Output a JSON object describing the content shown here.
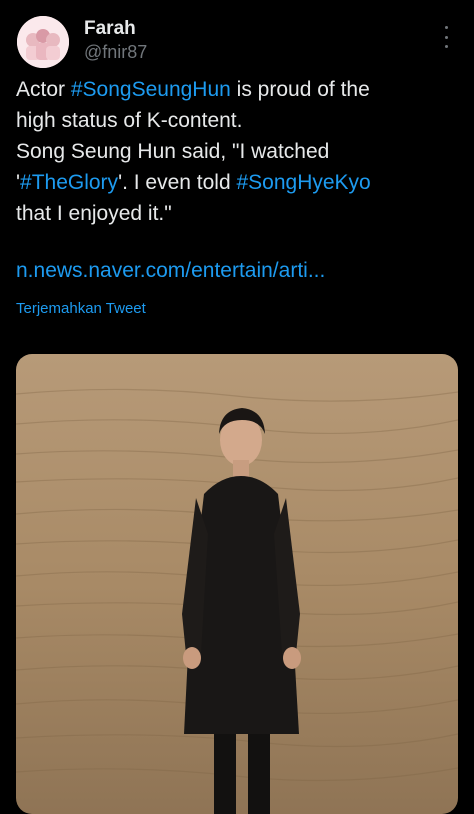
{
  "author": {
    "name": "Farah",
    "handle": "@fnir87",
    "avatar_icon": "avatar-illustration"
  },
  "menu": {
    "icon": "more-vertical-icon"
  },
  "tweet": {
    "lines": [
      [
        {
          "text": "Actor "
        },
        {
          "text": "#SongSeungHun",
          "link": true
        },
        {
          "text": " is proud of the"
        }
      ],
      [
        {
          "text": "high status of K-content."
        }
      ],
      [
        {
          "text": "Song Seung Hun said, \"I watched"
        }
      ],
      [
        {
          "text": "'"
        },
        {
          "text": "#TheGlory",
          "link": true
        },
        {
          "text": "'. I even told "
        },
        {
          "text": "#SongHyeKyo",
          "link": true
        }
      ],
      [
        {
          "text": "that I enjoyed it.\""
        }
      ]
    ],
    "url": "n.news.naver.com/entertain/arti...",
    "translate_label": "Terjemahkan Tweet"
  },
  "media": {
    "description_icon": "photo"
  },
  "colors": {
    "background": "#000000",
    "text": "#e7e9ea",
    "secondary": "#71767b",
    "link": "#1d9bf0"
  }
}
